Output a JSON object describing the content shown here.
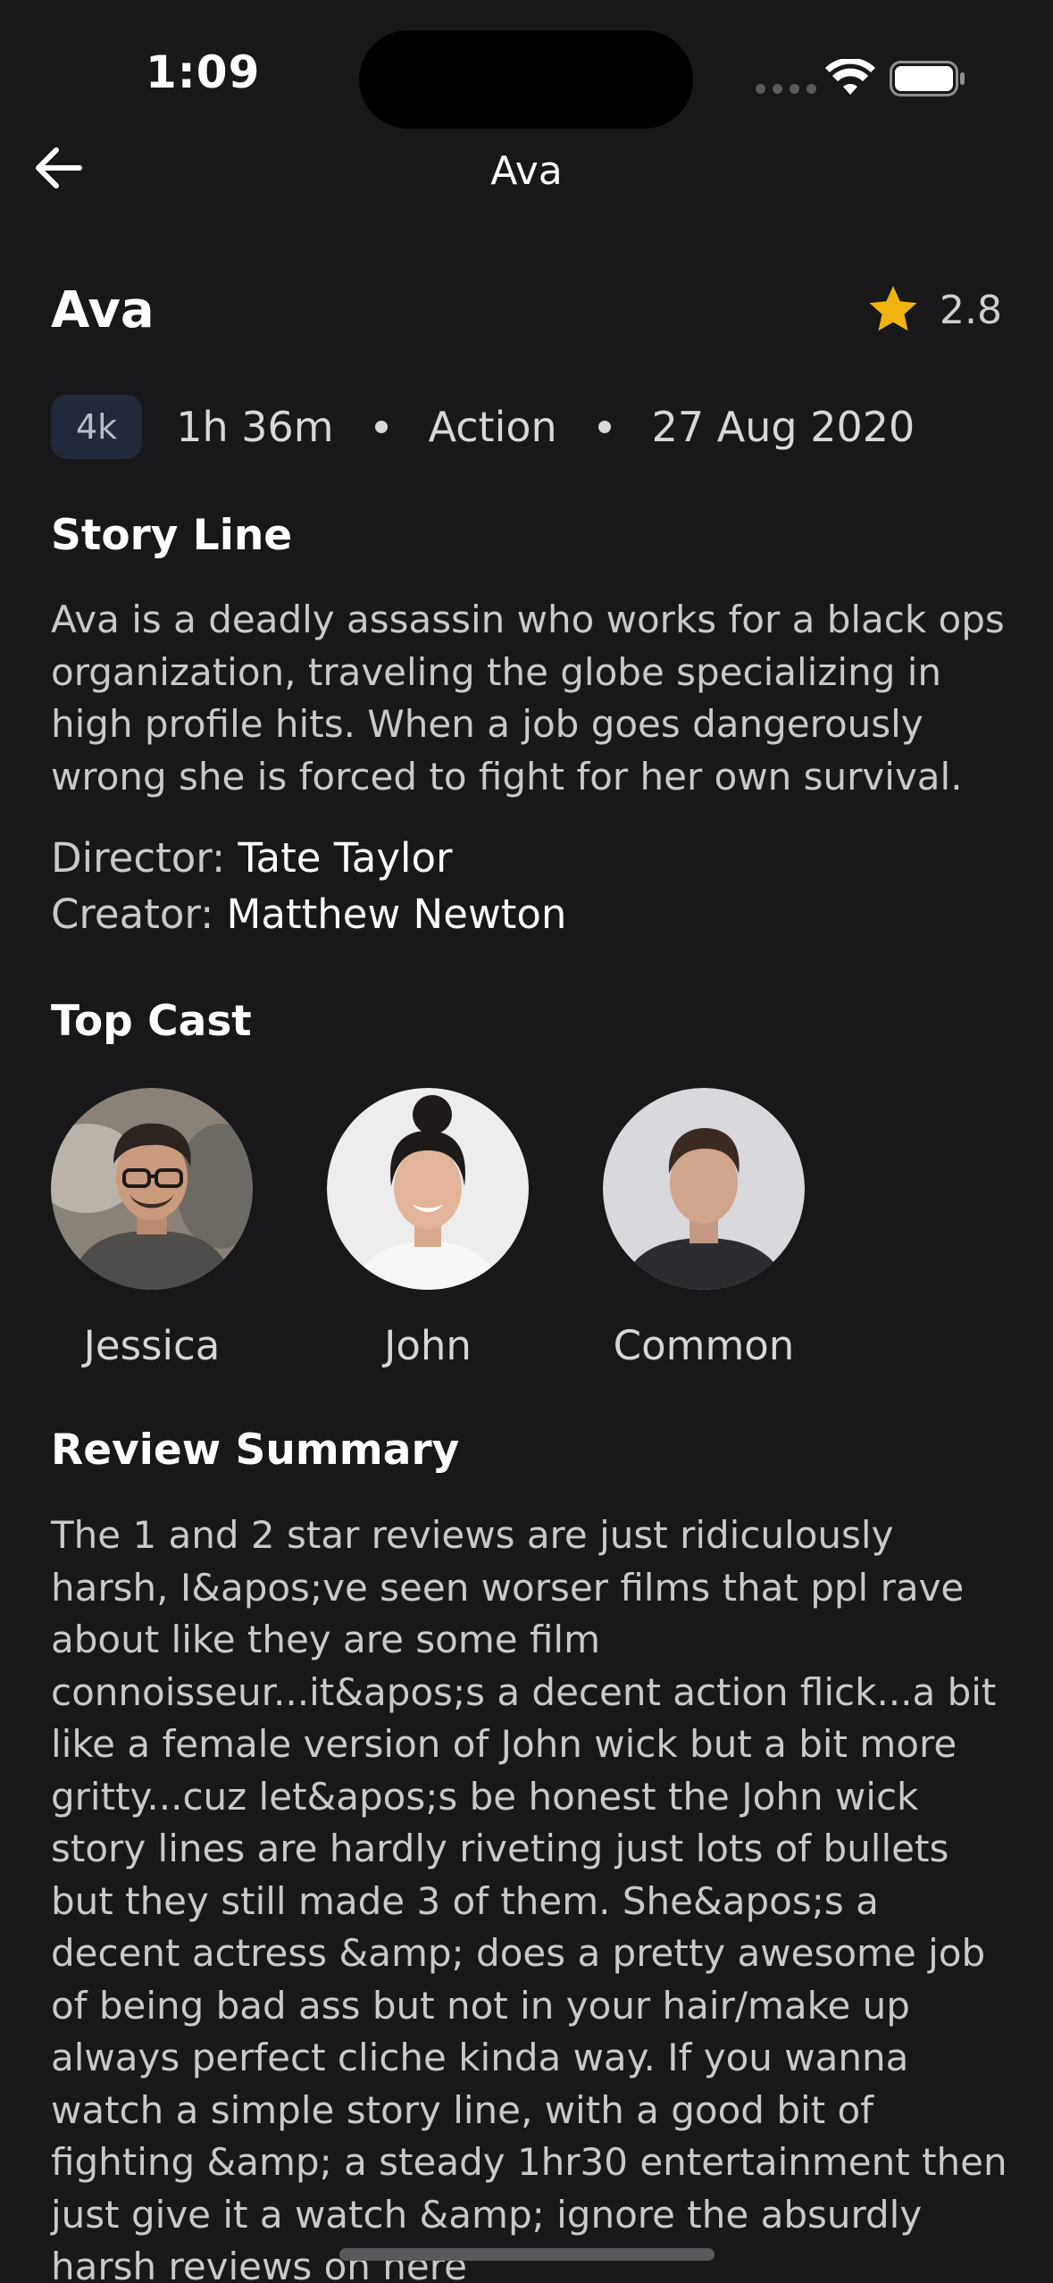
{
  "status_bar": {
    "time": "1:09"
  },
  "nav": {
    "title": "Ava"
  },
  "movie": {
    "title": "Ava",
    "rating": "2.8",
    "quality_badge": "4k",
    "duration": "1h 36m",
    "genre": "Action",
    "release_date": "27 Aug 2020"
  },
  "story": {
    "heading": "Story Line",
    "text": "Ava is a deadly assassin who works for a black ops organization, traveling the globe specializing in high profile hits. When a job goes dangerously wrong she is forced to fight for her own survival."
  },
  "credits": {
    "director_label": "Director: ",
    "director": "Tate Taylor",
    "creator_label": "Creator: ",
    "creator": "Matthew Newton"
  },
  "cast": {
    "heading": "Top Cast",
    "members": [
      {
        "name": "Jessica"
      },
      {
        "name": "John"
      },
      {
        "name": "Common"
      }
    ]
  },
  "review": {
    "heading": "Review Summary",
    "text": "The 1 and 2 star reviews are just ridiculously harsh, I&apos;ve seen worser films that ppl rave about like they are some film connoisseur...it&apos;s a decent action flick...a bit like a female version of John wick but a bit more gritty...cuz let&apos;s be honest the John wick story lines are hardly riveting just lots of bullets but they still made 3 of them. She&apos;s a decent actress &amp; does a pretty awesome job of being bad ass but not in your hair/make up always perfect cliche kinda way. If you wanna watch a simple story line, with a good bit of fighting &amp; a steady 1hr30 entertainment then just give it a watch &amp; ignore the absurdly harsh reviews on here"
  },
  "colors": {
    "background": "#18181a",
    "star": "#f2b40f",
    "badge_bg": "#22293a"
  }
}
